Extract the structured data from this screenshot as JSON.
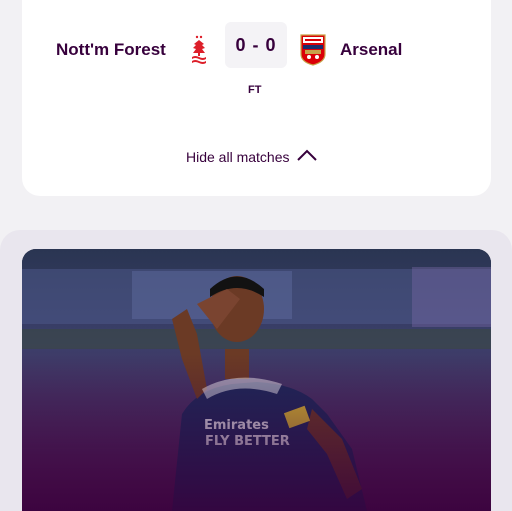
{
  "match": {
    "home_team": "Nott'm Forest",
    "away_team": "Arsenal",
    "score": "0 - 0",
    "status": "FT",
    "home_crest_icon": "nottingham-forest-crest-icon",
    "away_crest_icon": "arsenal-crest-icon"
  },
  "toggle": {
    "label": "Hide all matches",
    "icon": "chevron-up-icon"
  },
  "colors": {
    "primary_text": "#37003c",
    "forest_red": "#dd1f2a",
    "arsenal_red": "#db0007",
    "card_bg": "#ffffff",
    "page_bg": "#f2f1f4"
  }
}
